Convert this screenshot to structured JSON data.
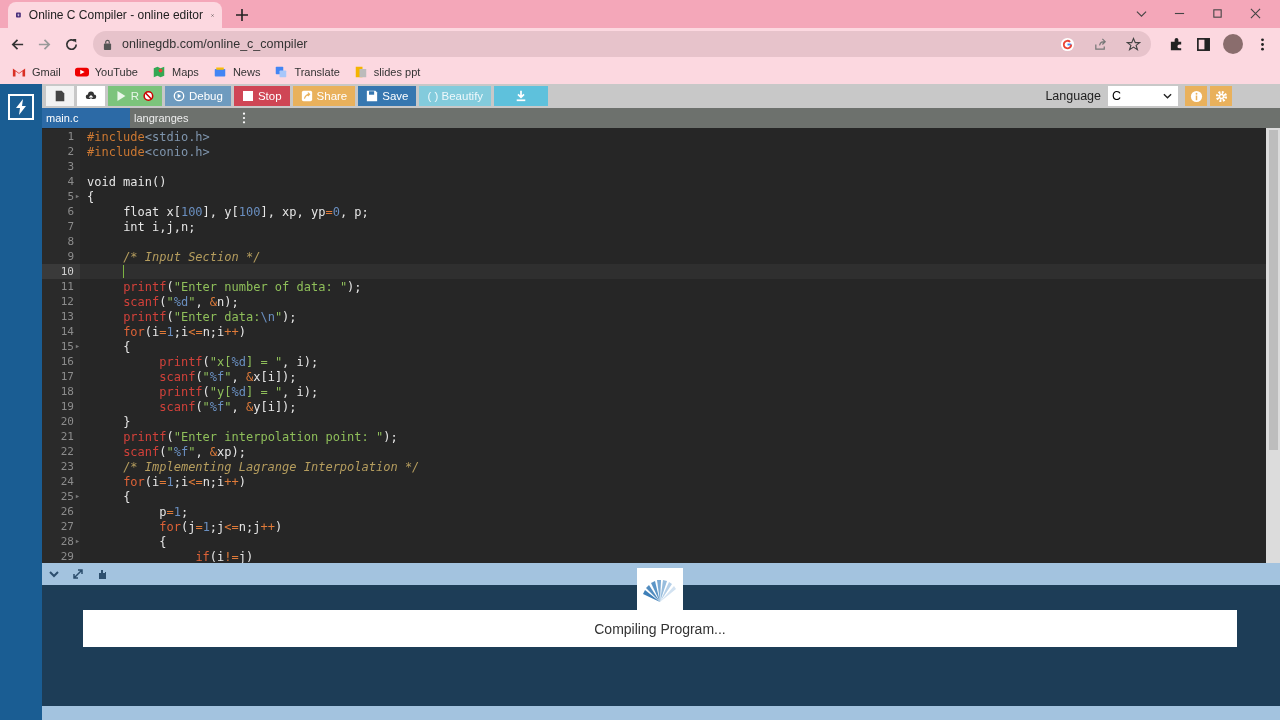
{
  "browser": {
    "tab_title": "Online C Compiler - online editor",
    "address": "onlinegdb.com/online_c_compiler",
    "bookmarks": [
      {
        "label": "Gmail",
        "kind": "gmail"
      },
      {
        "label": "YouTube",
        "kind": "youtube"
      },
      {
        "label": "Maps",
        "kind": "maps"
      },
      {
        "label": "News",
        "kind": "news"
      },
      {
        "label": "Translate",
        "kind": "translate"
      },
      {
        "label": "slides ppt",
        "kind": "folder"
      }
    ]
  },
  "toolbar": {
    "buttons": [
      {
        "kind": "newfile",
        "color": "#f2f2f2"
      },
      {
        "kind": "upload",
        "color": "#ffffff"
      },
      {
        "kind": "run",
        "label": "R",
        "color": "#7cc47c"
      },
      {
        "kind": "debug",
        "label": "Debug",
        "color": "#6e9bbf"
      },
      {
        "kind": "stop",
        "label": "Stop",
        "color": "#cf4655"
      },
      {
        "kind": "share",
        "label": "Share",
        "color": "#e9b15c"
      },
      {
        "kind": "save",
        "label": "Save",
        "color": "#3677b0"
      },
      {
        "kind": "beautify",
        "label": "( ) Beautify",
        "color": "#83cbdc"
      },
      {
        "kind": "download",
        "color": "#5ec1dc"
      }
    ],
    "language_label": "Language",
    "language": "C"
  },
  "file_tabs": [
    {
      "label": "main.c",
      "selected": true
    },
    {
      "label": "langranges",
      "selected": false
    }
  ],
  "editor": {
    "lines": [
      {
        "no": "1",
        "fold": false,
        "active": false,
        "tokens": [
          {
            "t": "#include",
            "kind": "directive"
          },
          {
            "t": "<stdio.h>",
            "kind": "header"
          }
        ]
      },
      {
        "no": "2",
        "fold": false,
        "active": false,
        "tokens": [
          {
            "t": "#include",
            "kind": "directive"
          },
          {
            "t": "<conio.h>",
            "kind": "header"
          }
        ]
      },
      {
        "no": "3",
        "fold": false,
        "active": false
      },
      {
        "no": "4",
        "fold": false,
        "active": false,
        "tokens": [
          {
            "t": "void main()",
            "kind": "plain"
          }
        ]
      },
      {
        "no": "5",
        "fold": true,
        "active": false,
        "tokens": [
          {
            "t": "{",
            "kind": "plain"
          }
        ]
      },
      {
        "no": "6",
        "fold": false,
        "active": false,
        "tokens": [
          {
            "t": "\tfloat x[",
            "kind": "plain"
          },
          {
            "t": "100",
            "kind": "number"
          },
          {
            "t": "], y[",
            "kind": "plain"
          },
          {
            "t": "100",
            "kind": "number"
          },
          {
            "t": "], xp, yp",
            "kind": "plain"
          },
          {
            "t": "=",
            "kind": "operator"
          },
          {
            "t": "0",
            "kind": "number"
          },
          {
            "t": ", p;",
            "kind": "plain"
          }
        ]
      },
      {
        "no": "7",
        "fold": false,
        "active": false,
        "tokens": [
          {
            "t": "\tint i,j,n;",
            "kind": "plain"
          }
        ]
      },
      {
        "no": "8",
        "fold": false,
        "active": false
      },
      {
        "no": "9",
        "fold": false,
        "active": false,
        "tokens": [
          {
            "t": "\t/* Input Section */",
            "kind": "comment"
          }
        ]
      },
      {
        "no": "10",
        "fold": false,
        "active": true
      },
      {
        "no": "11",
        "fold": false,
        "active": false,
        "tokens": [
          {
            "t": "\tprintf",
            "kind": "function"
          },
          {
            "t": "(",
            "kind": "plain"
          },
          {
            "t": "\"Enter number of data: \"",
            "kind": "string"
          },
          {
            "t": ");",
            "kind": "plain"
          }
        ]
      },
      {
        "no": "12",
        "fold": false,
        "active": false,
        "tokens": [
          {
            "t": "\tscanf",
            "kind": "function"
          },
          {
            "t": "(",
            "kind": "plain"
          },
          {
            "t": "\"",
            "kind": "string"
          },
          {
            "t": "%d",
            "kind": "number"
          },
          {
            "t": "\"",
            "kind": "string"
          },
          {
            "t": ", ",
            "kind": "plain"
          },
          {
            "t": "&",
            "kind": "operator"
          },
          {
            "t": "n);",
            "kind": "plain"
          }
        ]
      },
      {
        "no": "13",
        "fold": false,
        "active": false,
        "tokens": [
          {
            "t": "\tprintf",
            "kind": "function"
          },
          {
            "t": "(",
            "kind": "plain"
          },
          {
            "t": "\"Enter data:",
            "kind": "string"
          },
          {
            "t": "\\n",
            "kind": "number"
          },
          {
            "t": "\"",
            "kind": "string"
          },
          {
            "t": ");",
            "kind": "plain"
          }
        ]
      },
      {
        "no": "14",
        "fold": false,
        "active": false,
        "tokens": [
          {
            "t": "\tfor",
            "kind": "keyword"
          },
          {
            "t": "(i",
            "kind": "plain"
          },
          {
            "t": "=",
            "kind": "operator"
          },
          {
            "t": "1",
            "kind": "number"
          },
          {
            "t": ";i",
            "kind": "plain"
          },
          {
            "t": "<=",
            "kind": "operator"
          },
          {
            "t": "n;i",
            "kind": "plain"
          },
          {
            "t": "++",
            "kind": "operator"
          },
          {
            "t": ")",
            "kind": "plain"
          }
        ]
      },
      {
        "no": "15",
        "fold": true,
        "active": false,
        "tokens": [
          {
            "t": "\t{",
            "kind": "plain"
          }
        ]
      },
      {
        "no": "16",
        "fold": false,
        "active": false,
        "tokens": [
          {
            "t": "\t\tprintf",
            "kind": "function"
          },
          {
            "t": "(",
            "kind": "plain"
          },
          {
            "t": "\"x[",
            "kind": "string"
          },
          {
            "t": "%d",
            "kind": "number"
          },
          {
            "t": "] = \"",
            "kind": "string"
          },
          {
            "t": ", i);",
            "kind": "plain"
          }
        ]
      },
      {
        "no": "17",
        "fold": false,
        "active": false,
        "tokens": [
          {
            "t": "\t\tscanf",
            "kind": "function"
          },
          {
            "t": "(",
            "kind": "plain"
          },
          {
            "t": "\"",
            "kind": "string"
          },
          {
            "t": "%f",
            "kind": "number"
          },
          {
            "t": "\"",
            "kind": "string"
          },
          {
            "t": ", ",
            "kind": "plain"
          },
          {
            "t": "&",
            "kind": "operator"
          },
          {
            "t": "x[i]);",
            "kind": "plain"
          }
        ]
      },
      {
        "no": "18",
        "fold": false,
        "active": false,
        "tokens": [
          {
            "t": "\t\tprintf",
            "kind": "function"
          },
          {
            "t": "(",
            "kind": "plain"
          },
          {
            "t": "\"y[",
            "kind": "string"
          },
          {
            "t": "%d",
            "kind": "number"
          },
          {
            "t": "] = \"",
            "kind": "string"
          },
          {
            "t": ", i);",
            "kind": "plain"
          }
        ]
      },
      {
        "no": "19",
        "fold": false,
        "active": false,
        "tokens": [
          {
            "t": "\t\tscanf",
            "kind": "function"
          },
          {
            "t": "(",
            "kind": "plain"
          },
          {
            "t": "\"",
            "kind": "string"
          },
          {
            "t": "%f",
            "kind": "number"
          },
          {
            "t": "\"",
            "kind": "string"
          },
          {
            "t": ", ",
            "kind": "plain"
          },
          {
            "t": "&",
            "kind": "operator"
          },
          {
            "t": "y[i]);",
            "kind": "plain"
          }
        ]
      },
      {
        "no": "20",
        "fold": false,
        "active": false,
        "tokens": [
          {
            "t": "\t}",
            "kind": "plain"
          }
        ]
      },
      {
        "no": "21",
        "fold": false,
        "active": false,
        "tokens": [
          {
            "t": "\tprintf",
            "kind": "function"
          },
          {
            "t": "(",
            "kind": "plain"
          },
          {
            "t": "\"Enter interpolation point: \"",
            "kind": "string"
          },
          {
            "t": ");",
            "kind": "plain"
          }
        ]
      },
      {
        "no": "22",
        "fold": false,
        "active": false,
        "tokens": [
          {
            "t": "\tscanf",
            "kind": "function"
          },
          {
            "t": "(",
            "kind": "plain"
          },
          {
            "t": "\"",
            "kind": "string"
          },
          {
            "t": "%f",
            "kind": "number"
          },
          {
            "t": "\"",
            "kind": "string"
          },
          {
            "t": ", ",
            "kind": "plain"
          },
          {
            "t": "&",
            "kind": "operator"
          },
          {
            "t": "xp);",
            "kind": "plain"
          }
        ]
      },
      {
        "no": "23",
        "fold": false,
        "active": false,
        "tokens": [
          {
            "t": "\t/* Implementing Lagrange Interpolation */",
            "kind": "comment"
          }
        ]
      },
      {
        "no": "24",
        "fold": false,
        "active": false,
        "tokens": [
          {
            "t": "\tfor",
            "kind": "keyword"
          },
          {
            "t": "(i",
            "kind": "plain"
          },
          {
            "t": "=",
            "kind": "operator"
          },
          {
            "t": "1",
            "kind": "number"
          },
          {
            "t": ";i",
            "kind": "plain"
          },
          {
            "t": "<=",
            "kind": "operator"
          },
          {
            "t": "n;i",
            "kind": "plain"
          },
          {
            "t": "++",
            "kind": "operator"
          },
          {
            "t": ")",
            "kind": "plain"
          }
        ]
      },
      {
        "no": "25",
        "fold": true,
        "active": false,
        "tokens": [
          {
            "t": "\t{",
            "kind": "plain"
          }
        ]
      },
      {
        "no": "26",
        "fold": false,
        "active": false,
        "tokens": [
          {
            "t": "\t\tp",
            "kind": "plain"
          },
          {
            "t": "=",
            "kind": "operator"
          },
          {
            "t": "1",
            "kind": "number"
          },
          {
            "t": ";",
            "kind": "plain"
          }
        ]
      },
      {
        "no": "27",
        "fold": false,
        "active": false,
        "tokens": [
          {
            "t": "\t\tfor",
            "kind": "keyword"
          },
          {
            "t": "(j",
            "kind": "plain"
          },
          {
            "t": "=",
            "kind": "operator"
          },
          {
            "t": "1",
            "kind": "number"
          },
          {
            "t": ";j",
            "kind": "plain"
          },
          {
            "t": "<=",
            "kind": "operator"
          },
          {
            "t": "n;j",
            "kind": "plain"
          },
          {
            "t": "++",
            "kind": "operator"
          },
          {
            "t": ")",
            "kind": "plain"
          }
        ]
      },
      {
        "no": "28",
        "fold": true,
        "active": false,
        "tokens": [
          {
            "t": "\t\t{",
            "kind": "plain"
          }
        ]
      },
      {
        "no": "29",
        "fold": false,
        "active": false,
        "tokens": [
          {
            "t": "\t\t\tif",
            "kind": "keyword"
          },
          {
            "t": "(i",
            "kind": "plain"
          },
          {
            "t": "!=",
            "kind": "operator"
          },
          {
            "t": "j)",
            "kind": "plain"
          }
        ]
      }
    ]
  },
  "output": {
    "message": "Compiling Program..."
  }
}
